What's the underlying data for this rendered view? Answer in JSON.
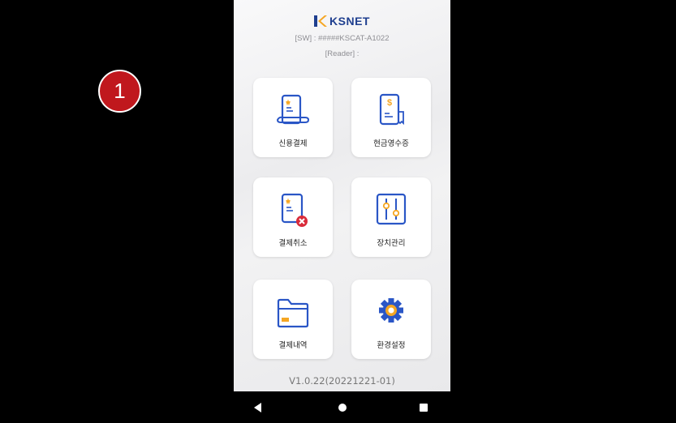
{
  "annotation": {
    "badge_number": "1"
  },
  "header": {
    "brand": "KSNET",
    "sw_line": "[SW] : #####KSCAT-A1022",
    "reader_line": "[Reader] :"
  },
  "menu": {
    "credit_payment": "신용결제",
    "cash_receipt": "현금영수증",
    "cancel_payment": "결제취소",
    "device_management": "장치관리",
    "payment_history": "결제내역",
    "settings": "환경설정"
  },
  "footer": {
    "version": "V1.0.22(20221221-01)"
  },
  "colors": {
    "brand_blue": "#1f3f8f",
    "icon_blue": "#2a56c6",
    "accent_yellow": "#f5a623",
    "danger_red": "#d92b3a",
    "badge_red": "#c0181d"
  }
}
